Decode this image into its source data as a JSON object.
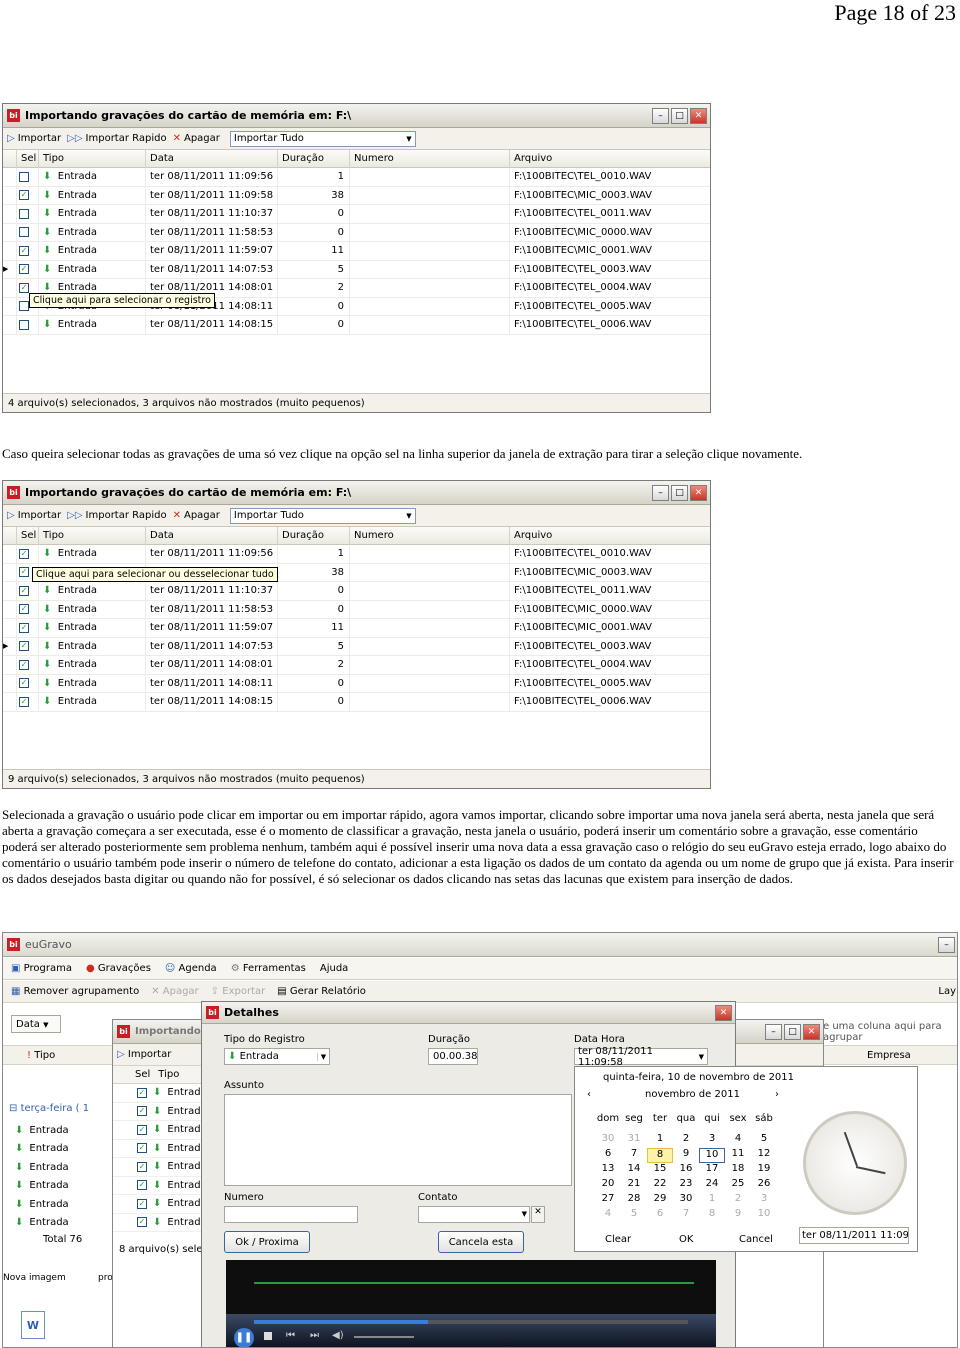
{
  "page_header": "Page 18 of 23",
  "window1": {
    "title": "Importando gravações do cartão de memória em:  F:\\",
    "toolbar": {
      "import": "Importar",
      "import_quick": "Importar Rapido",
      "delete": "Apagar",
      "combo": "Importar Tudo"
    },
    "columns": [
      "Sel",
      "Tipo",
      "Data",
      "Duração",
      "Numero",
      "Arquivo"
    ],
    "rows": [
      {
        "checked": false,
        "tipo": "Entrada",
        "data": "ter 08/11/2011 11:09:56",
        "dur": "1",
        "arq": "F:\\100BITEC\\TEL_0010.WAV"
      },
      {
        "checked": true,
        "tipo": "Entrada",
        "data": "ter 08/11/2011 11:09:58",
        "dur": "38",
        "arq": "F:\\100BITEC\\MIC_0003.WAV"
      },
      {
        "checked": false,
        "tipo": "Entrada",
        "data": "ter 08/11/2011 11:10:37",
        "dur": "0",
        "arq": "F:\\100BITEC\\TEL_0011.WAV"
      },
      {
        "checked": false,
        "tipo": "Entrada",
        "data": "ter 08/11/2011 11:58:53",
        "dur": "0",
        "arq": "F:\\100BITEC\\MIC_0000.WAV"
      },
      {
        "checked": true,
        "tipo": "Entrada",
        "data": "ter 08/11/2011 11:59:07",
        "dur": "11",
        "arq": "F:\\100BITEC\\MIC_0001.WAV"
      },
      {
        "checked": true,
        "tipo": "Entrada",
        "data": "ter 08/11/2011 14:07:53",
        "dur": "5",
        "arq": "F:\\100BITEC\\TEL_0003.WAV"
      },
      {
        "checked": true,
        "tipo": "Entrada",
        "data": "ter 08/11/2011 14:08:01",
        "dur": "2",
        "arq": "F:\\100BITEC\\TEL_0004.WAV"
      },
      {
        "checked": false,
        "tipo": "Entrada",
        "data": "ter 08/11/2011 14:08:11",
        "dur": "0",
        "arq": "F:\\100BITEC\\TEL_0005.WAV"
      },
      {
        "checked": false,
        "tipo": "Entrada",
        "data": "ter 08/11/2011 14:08:15",
        "dur": "0",
        "arq": "F:\\100BITEC\\TEL_0006.WAV"
      }
    ],
    "tooltip": "Clique aqui para selecionar o registro",
    "status": "4 arquivo(s) selecionados, 3 arquivos não mostrados (muito pequenos)"
  },
  "paragraph1": "Caso queira selecionar todas as gravações de uma só vez clique na opção sel na linha superior da janela de extração para tirar a seleção clique novamente.",
  "window2": {
    "title": "Importando gravações do cartão de memória em:  F:\\",
    "toolbar": {
      "import": "Importar",
      "import_quick": "Importar Rapido",
      "delete": "Apagar",
      "combo": "Importar Tudo"
    },
    "columns": [
      "Sel",
      "Tipo",
      "Data",
      "Duração",
      "Numero",
      "Arquivo"
    ],
    "rows": [
      {
        "checked": true,
        "tipo": "Entrada",
        "data": "ter 08/11/2011 11:09:56",
        "dur": "1",
        "arq": "F:\\100BITEC\\TEL_0010.WAV"
      },
      {
        "checked": true,
        "tipo": "Entrada",
        "data": "ter 08/11/2011 11:09:58",
        "dur": "38",
        "arq": "F:\\100BITEC\\MIC_0003.WAV"
      },
      {
        "checked": true,
        "tipo": "Entrada",
        "data": "ter 08/11/2011 11:10:37",
        "dur": "0",
        "arq": "F:\\100BITEC\\TEL_0011.WAV"
      },
      {
        "checked": true,
        "tipo": "Entrada",
        "data": "ter 08/11/2011 11:58:53",
        "dur": "0",
        "arq": "F:\\100BITEC\\MIC_0000.WAV"
      },
      {
        "checked": true,
        "tipo": "Entrada",
        "data": "ter 08/11/2011 11:59:07",
        "dur": "11",
        "arq": "F:\\100BITEC\\MIC_0001.WAV"
      },
      {
        "checked": true,
        "tipo": "Entrada",
        "data": "ter 08/11/2011 14:07:53",
        "dur": "5",
        "arq": "F:\\100BITEC\\TEL_0003.WAV"
      },
      {
        "checked": true,
        "tipo": "Entrada",
        "data": "ter 08/11/2011 14:08:01",
        "dur": "2",
        "arq": "F:\\100BITEC\\TEL_0004.WAV"
      },
      {
        "checked": true,
        "tipo": "Entrada",
        "data": "ter 08/11/2011 14:08:11",
        "dur": "0",
        "arq": "F:\\100BITEC\\TEL_0005.WAV"
      },
      {
        "checked": true,
        "tipo": "Entrada",
        "data": "ter 08/11/2011 14:08:15",
        "dur": "0",
        "arq": "F:\\100BITEC\\TEL_0006.WAV"
      }
    ],
    "tooltip": "Clique aqui para selecionar ou desselecionar tudo",
    "status": "9 arquivo(s) selecionados, 3 arquivos não mostrados (muito pequenos)"
  },
  "paragraph2": "Selecionada a gravação o usuário pode clicar em importar ou em importar rápido, agora vamos importar, clicando sobre importar uma nova janela será aberta, nesta janela que será aberta a gravação começara a ser executada, esse é o momento de classificar a gravação, nesta janela o usuário, poderá inserir um comentário sobre a gravação, esse comentário poderá ser alterado posteriormente sem problema nenhum, também aqui é possível inserir uma nova data a essa gravação caso o relógio do seu euGravo esteja errado, logo abaixo do comentário o usuário também pode inserir o número de telefone do contato, adicionar a esta ligação os dados de um contato da agenda ou um nome de grupo que já exista. Para inserir os dados desejados basta digitar ou quando não for possível, é só selecionar os dados clicando nas setas das lacunas que existem para inserção de dados.",
  "app": {
    "title": "euGravo",
    "menu": [
      "Programa",
      "Gravações",
      "Agenda",
      "Ferramentas",
      "Ajuda"
    ],
    "toolbar": [
      "Remover agrupamento",
      "Apagar",
      "Exportar",
      "Gerar Relatório"
    ],
    "toolbar_right": "Lay",
    "group_hint": "e uma coluna aqui para agrupar",
    "date_filter": "Data",
    "col_tipo": "Tipo",
    "col_empresa": "Empresa",
    "group_label": "terça-feira ( 1",
    "entries": [
      "Entrada",
      "Entrada",
      "Entrada",
      "Entrada",
      "Entrada",
      "Entrada"
    ],
    "total": "Total 76",
    "desktop_label1": "Nova imagem",
    "desktop_label2": "pro",
    "bg_window": {
      "title": "Importando",
      "import": "Importar",
      "cols": [
        "Sel",
        "Tipo"
      ],
      "rows": [
        "Entrad",
        "Entrad",
        "Entrad",
        "Entrad",
        "Entrad",
        "Entrad",
        "Entrad",
        "Entrad"
      ],
      "status": "8 arquivo(s) selecio"
    }
  },
  "detalhes": {
    "title": "Detalhes",
    "tipo_label": "Tipo do Registro",
    "tipo_value": "Entrada",
    "duracao_label": "Duração",
    "duracao_value": "00.00.38",
    "datahora_label": "Data Hora",
    "datahora_value": "ter 08/11/2011 11:09:58",
    "assunto_label": "Assunto",
    "numero_label": "Numero",
    "contato_label": "Contato",
    "ok_button": "Ok / Proxima",
    "cancel_button": "Cancela esta"
  },
  "calendar": {
    "header": "quinta-feira, 10 de novembro de 2011",
    "month": "novembro de 2011",
    "weekdays": [
      "dom",
      "seg",
      "ter",
      "qua",
      "qui",
      "sex",
      "sáb"
    ],
    "weeks": [
      [
        "30",
        "31",
        "1",
        "2",
        "3",
        "4",
        "5"
      ],
      [
        "6",
        "7",
        "8",
        "9",
        "10",
        "11",
        "12"
      ],
      [
        "13",
        "14",
        "15",
        "16",
        "17",
        "18",
        "19"
      ],
      [
        "20",
        "21",
        "22",
        "23",
        "24",
        "25",
        "26"
      ],
      [
        "27",
        "28",
        "29",
        "30",
        "1",
        "2",
        "3"
      ],
      [
        "4",
        "5",
        "6",
        "7",
        "8",
        "9",
        "10"
      ]
    ],
    "clear": "Clear",
    "ok": "OK",
    "cancel": "Cancel",
    "value": "ter 08/11/2011 11:09:"
  },
  "player": {
    "progress": 0.4
  }
}
